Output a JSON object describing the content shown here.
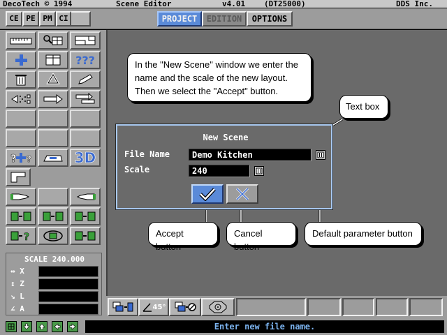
{
  "titlebar": {
    "company": "DecoTech © 1994",
    "app_name": "Scene Editor",
    "version": "v4.01",
    "code": "(DT25000)",
    "vendor": "DDS Inc."
  },
  "mode_buttons": [
    {
      "label": "CE"
    },
    {
      "label": "PE"
    },
    {
      "label": "PM"
    },
    {
      "label": "CI"
    }
  ],
  "tabs": [
    {
      "label": "PROJECT",
      "state": "active"
    },
    {
      "label": "EDITION",
      "state": "disabled"
    },
    {
      "label": "OPTIONS",
      "state": "normal"
    }
  ],
  "toolbox": {
    "icons": [
      "ruler-icon",
      "magnify-grid-icon",
      "floorplan-icon",
      "plus-icon",
      "cabinet-icon",
      "question-marks-icon",
      "trash-icon",
      "recycle-icon",
      "pencil-icon",
      "speaker-dotted-icon",
      "move-arrow-icon",
      "swap-arrow-icon",
      "question-plus-icon",
      "scanner-icon",
      "3d-label-icon",
      "wall-corner-icon",
      "hand-point-right-icon",
      "hand-point-left-icon",
      "grid-to-grid-icon",
      "grid-to-grid-icon",
      "grid-to-grid-icon",
      "grid-question-icon",
      "oval-grid-icon",
      "grid-to-grid-icon"
    ],
    "label_3d": "3D",
    "question_label": "???"
  },
  "scale_panel": {
    "title": "SCALE 240.000",
    "rows": [
      {
        "label": "X",
        "icon": "horizontal-arrows-icon"
      },
      {
        "label": "Z",
        "icon": "vertical-arrows-icon"
      },
      {
        "label": "L",
        "icon": "diagonal-arrow-icon"
      },
      {
        "label": "A",
        "icon": "angle-icon"
      }
    ]
  },
  "dialog": {
    "title": "New Scene",
    "file_name_label": "File Name",
    "file_name_value": "Demo Kitchen",
    "scale_label": "Scale",
    "scale_value": "240"
  },
  "callouts": {
    "intro": "In the \"New Scene\" window we enter the name and the scale of the new layout. Then we select the \"Accept\" button.",
    "text_box": "Text box",
    "accept": "Accept button",
    "cancel": "Cancel button",
    "default_param": "Default parameter button"
  },
  "bottom_toolbar": {
    "angle_label": "45°"
  },
  "status": {
    "message": "Enter new file name."
  },
  "colors": {
    "panel_grey": "#9c9c9c",
    "workspace": "#6a6a6a",
    "active_tab": "#5a8ad8",
    "status_text": "#7cb4f0",
    "dialog_border": "#a8c8f0"
  }
}
